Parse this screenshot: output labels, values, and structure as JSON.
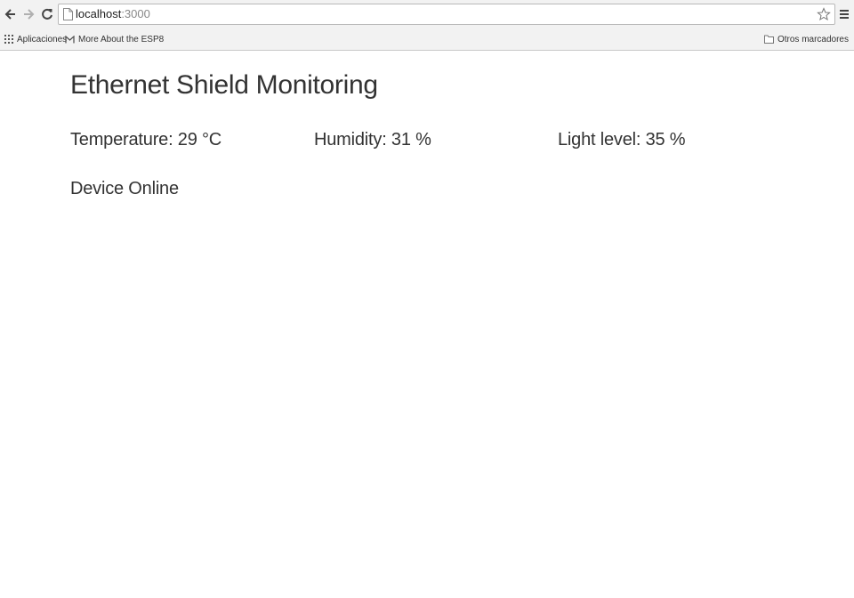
{
  "browser": {
    "url_host": "localhost",
    "url_port": ":3000",
    "bookmarks": {
      "apps": "Aplicaciones",
      "more": "More About the ESP8",
      "other": "Otros marcadores"
    },
    "icons": {
      "back": "back-arrow-icon",
      "forward": "forward-arrow-icon",
      "reload": "reload-icon",
      "page": "page-icon",
      "star": "star-icon",
      "menu": "hamburger-menu-icon",
      "apps": "apps-grid-icon",
      "gmail": "gmail-icon",
      "folder": "folder-icon"
    }
  },
  "page": {
    "title": "Ethernet Shield Monitoring",
    "temperature": "Temperature: 29 °C",
    "humidity": "Humidity: 31 %",
    "light": "Light level: 35 %",
    "status": "Device Online"
  }
}
